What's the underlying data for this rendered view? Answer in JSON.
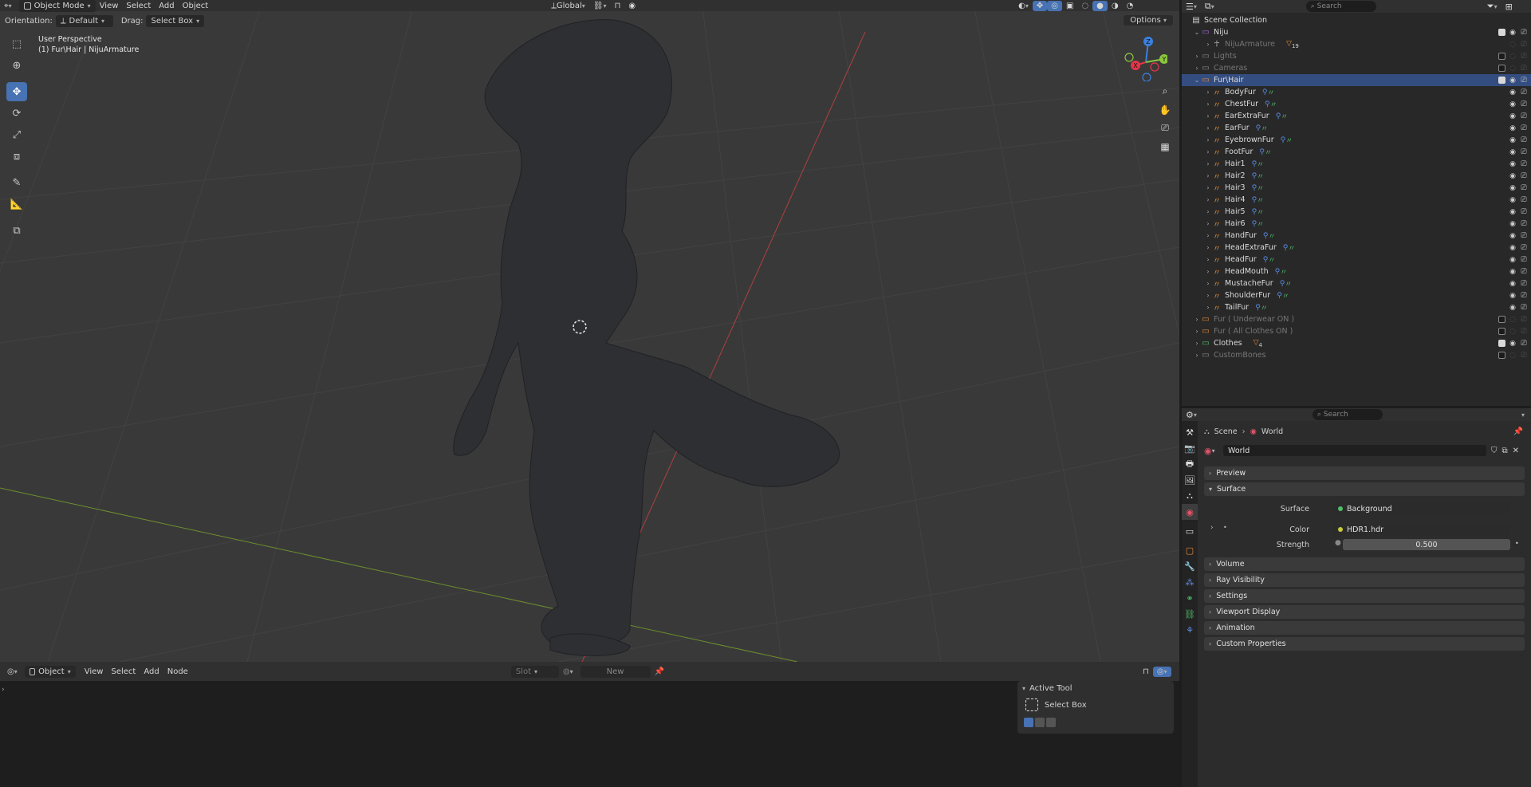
{
  "viewport": {
    "mode": "Object Mode",
    "menus": [
      "View",
      "Select",
      "Add",
      "Object"
    ],
    "transform_orientation": "Global",
    "orientation_label": "Orientation:",
    "orientation_value": "Default",
    "drag_label": "Drag:",
    "drag_value": "Select Box",
    "options_label": "Options",
    "perspective": "User Perspective",
    "active_object": "(1) Fur\\Hair | NijuArmature",
    "gizmo_axes": {
      "x": "X",
      "y": "Y",
      "z": "Z"
    }
  },
  "shader_editor": {
    "mode": "Object",
    "menus": [
      "View",
      "Select",
      "Add",
      "Node"
    ],
    "slot_label": "Slot",
    "new_label": "New",
    "active_tool_title": "Active Tool",
    "active_tool_name": "Select Box"
  },
  "outliner": {
    "search_placeholder": "Search",
    "root": "Scene Collection",
    "rows": [
      {
        "name": "Niju",
        "icon": "collection-icon",
        "color": "#9d6bd6",
        "indent": 1,
        "expanded": true,
        "checked": true,
        "dim": false
      },
      {
        "name": "NijuArmature",
        "icon": "armature-icon",
        "color": "#b0b0b0",
        "indent": 2,
        "expanded": false,
        "checked": null,
        "dim": true,
        "badge": "19"
      },
      {
        "name": "Lights",
        "icon": "collection-icon",
        "color": "#888888",
        "indent": 1,
        "expanded": false,
        "checked": false,
        "dim": true
      },
      {
        "name": "Cameras",
        "icon": "collection-icon",
        "color": "#888888",
        "indent": 1,
        "expanded": false,
        "checked": false,
        "dim": true
      },
      {
        "name": "Fur\\Hair",
        "icon": "collection-icon",
        "color": "#e28a3a",
        "indent": 1,
        "expanded": true,
        "checked": true,
        "dim": false,
        "selected": true
      },
      {
        "name": "BodyFur",
        "icon": "hair-icon",
        "color": "#e28a3a",
        "indent": 2,
        "expanded": false,
        "checked": null,
        "dim": false
      },
      {
        "name": "ChestFur",
        "icon": "hair-icon",
        "color": "#e28a3a",
        "indent": 2,
        "expanded": false,
        "checked": null,
        "dim": false
      },
      {
        "name": "EarExtraFur",
        "icon": "hair-icon",
        "color": "#e28a3a",
        "indent": 2,
        "expanded": false,
        "checked": null,
        "dim": false
      },
      {
        "name": "EarFur",
        "icon": "hair-icon",
        "color": "#e28a3a",
        "indent": 2,
        "expanded": false,
        "checked": null,
        "dim": false
      },
      {
        "name": "EyebrownFur",
        "icon": "hair-icon",
        "color": "#e28a3a",
        "indent": 2,
        "expanded": false,
        "checked": null,
        "dim": false
      },
      {
        "name": "FootFur",
        "icon": "hair-icon",
        "color": "#e28a3a",
        "indent": 2,
        "expanded": false,
        "checked": null,
        "dim": false
      },
      {
        "name": "Hair1",
        "icon": "hair-icon",
        "color": "#e28a3a",
        "indent": 2,
        "expanded": false,
        "checked": null,
        "dim": false
      },
      {
        "name": "Hair2",
        "icon": "hair-icon",
        "color": "#e28a3a",
        "indent": 2,
        "expanded": false,
        "checked": null,
        "dim": false
      },
      {
        "name": "Hair3",
        "icon": "hair-icon",
        "color": "#e28a3a",
        "indent": 2,
        "expanded": false,
        "checked": null,
        "dim": false
      },
      {
        "name": "Hair4",
        "icon": "hair-icon",
        "color": "#e28a3a",
        "indent": 2,
        "expanded": false,
        "checked": null,
        "dim": false
      },
      {
        "name": "Hair5",
        "icon": "hair-icon",
        "color": "#e28a3a",
        "indent": 2,
        "expanded": false,
        "checked": null,
        "dim": false
      },
      {
        "name": "Hair6",
        "icon": "hair-icon",
        "color": "#e28a3a",
        "indent": 2,
        "expanded": false,
        "checked": null,
        "dim": false
      },
      {
        "name": "HandFur",
        "icon": "hair-icon",
        "color": "#e28a3a",
        "indent": 2,
        "expanded": false,
        "checked": null,
        "dim": false
      },
      {
        "name": "HeadExtraFur",
        "icon": "hair-icon",
        "color": "#e28a3a",
        "indent": 2,
        "expanded": false,
        "checked": null,
        "dim": false
      },
      {
        "name": "HeadFur",
        "icon": "hair-icon",
        "color": "#e28a3a",
        "indent": 2,
        "expanded": false,
        "checked": null,
        "dim": false
      },
      {
        "name": "HeadMouth",
        "icon": "hair-icon",
        "color": "#e28a3a",
        "indent": 2,
        "expanded": false,
        "checked": null,
        "dim": false
      },
      {
        "name": "MustacheFur",
        "icon": "hair-icon",
        "color": "#e28a3a",
        "indent": 2,
        "expanded": false,
        "checked": null,
        "dim": false
      },
      {
        "name": "ShoulderFur",
        "icon": "hair-icon",
        "color": "#e28a3a",
        "indent": 2,
        "expanded": false,
        "checked": null,
        "dim": false
      },
      {
        "name": "TailFur",
        "icon": "hair-icon",
        "color": "#e28a3a",
        "indent": 2,
        "expanded": false,
        "checked": null,
        "dim": false
      },
      {
        "name": "Fur ( Underwear ON )",
        "icon": "collection-icon",
        "color": "#e28a3a",
        "indent": 1,
        "expanded": false,
        "checked": false,
        "dim": true
      },
      {
        "name": "Fur ( All Clothes ON )",
        "icon": "collection-icon",
        "color": "#e28a3a",
        "indent": 1,
        "expanded": false,
        "checked": false,
        "dim": true
      },
      {
        "name": "Clothes",
        "icon": "collection-icon",
        "color": "#4fbf6a",
        "indent": 1,
        "expanded": false,
        "checked": true,
        "dim": false,
        "badge": "4"
      },
      {
        "name": "CustomBones",
        "icon": "collection-icon",
        "color": "#888888",
        "indent": 1,
        "expanded": false,
        "checked": false,
        "dim": true
      }
    ]
  },
  "properties": {
    "search_placeholder": "Search",
    "breadcrumb": [
      "Scene",
      "World"
    ],
    "datablock": "World",
    "panels": {
      "preview": "Preview",
      "surface": "Surface",
      "volume": "Volume",
      "ray_visibility": "Ray Visibility",
      "settings": "Settings",
      "viewport_display": "Viewport Display",
      "animation": "Animation",
      "custom_properties": "Custom Properties"
    },
    "surface_label": "Surface",
    "surface_value": "Background",
    "color_label": "Color",
    "color_value": "HDR1.hdr",
    "strength_label": "Strength",
    "strength_value": "0.500"
  },
  "colors": {
    "accent": "#4772b3",
    "selection": "#334d80",
    "axis_x": "#e5354a",
    "axis_y": "#8bc63f",
    "axis_z": "#3a80e0"
  }
}
